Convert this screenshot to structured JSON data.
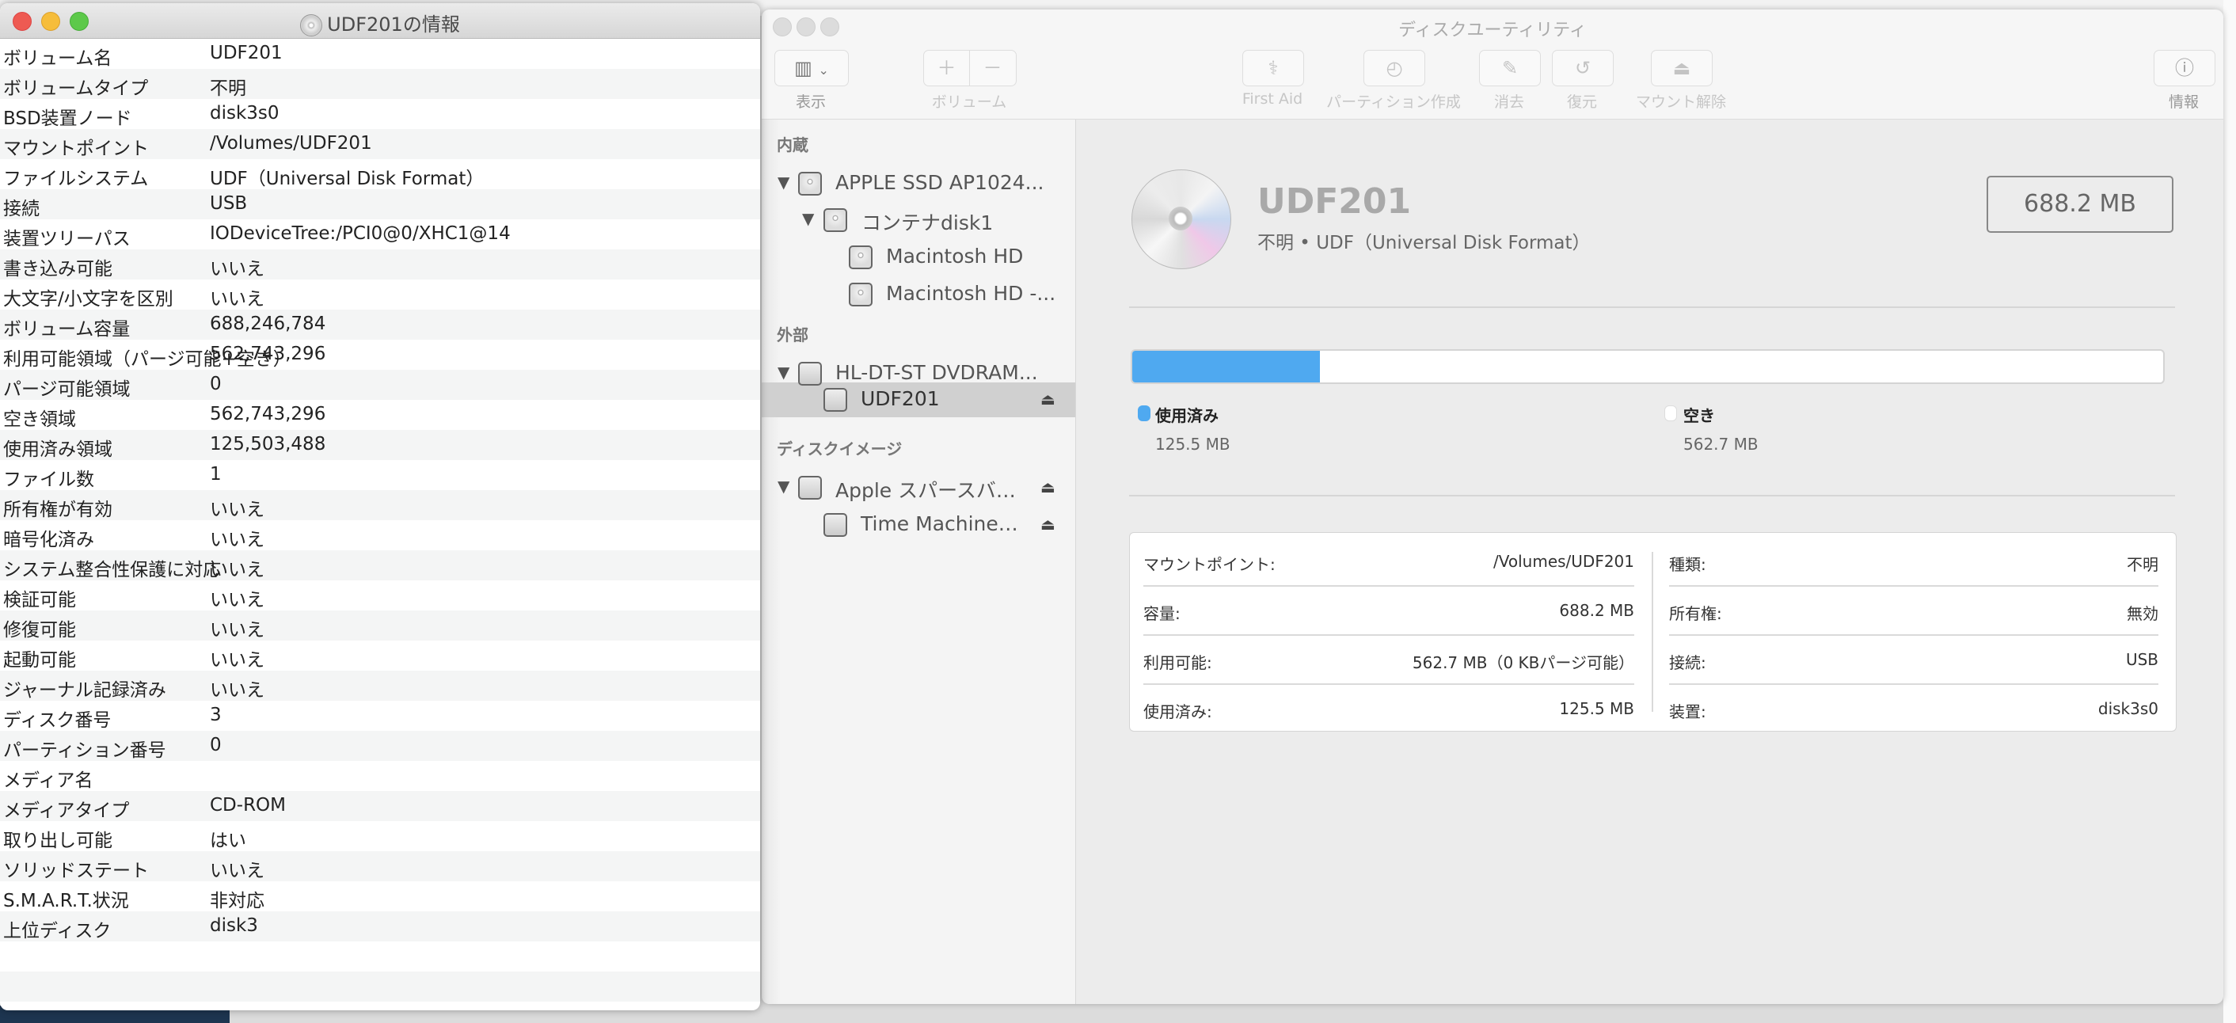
{
  "info_window": {
    "title": "UDF201の情報",
    "rows": [
      {
        "k": "ボリューム名",
        "v": "UDF201"
      },
      {
        "k": "ボリュームタイプ",
        "v": "不明"
      },
      {
        "k": "BSD装置ノード",
        "v": "disk3s0"
      },
      {
        "k": "マウントポイント",
        "v": "/Volumes/UDF201"
      },
      {
        "k": "ファイルシステム",
        "v": "UDF（Universal Disk Format）"
      },
      {
        "k": "接続",
        "v": "USB"
      },
      {
        "k": "装置ツリーパス",
        "v": "IODeviceTree:/PCI0@0/XHC1@14"
      },
      {
        "k": "書き込み可能",
        "v": "いいえ"
      },
      {
        "k": "大文字/小文字を区別",
        "v": "いいえ"
      },
      {
        "k": "ボリューム容量",
        "v": "688,246,784"
      },
      {
        "k": "利用可能領域（パージ可能+空き）",
        "v": "562,743,296"
      },
      {
        "k": "パージ可能領域",
        "v": "0"
      },
      {
        "k": "空き領域",
        "v": "562,743,296"
      },
      {
        "k": "使用済み領域",
        "v": "125,503,488"
      },
      {
        "k": "ファイル数",
        "v": "1"
      },
      {
        "k": "所有権が有効",
        "v": "いいえ"
      },
      {
        "k": "暗号化済み",
        "v": "いいえ"
      },
      {
        "k": "システム整合性保護に対応",
        "v": "いいえ"
      },
      {
        "k": "検証可能",
        "v": "いいえ"
      },
      {
        "k": "修復可能",
        "v": "いいえ"
      },
      {
        "k": "起動可能",
        "v": "いいえ"
      },
      {
        "k": "ジャーナル記録済み",
        "v": "いいえ"
      },
      {
        "k": "ディスク番号",
        "v": "3"
      },
      {
        "k": "パーティション番号",
        "v": "0"
      },
      {
        "k": "メディア名",
        "v": ""
      },
      {
        "k": "メディアタイプ",
        "v": "CD-ROM"
      },
      {
        "k": "取り出し可能",
        "v": "はい"
      },
      {
        "k": "ソリッドステート",
        "v": "いいえ"
      },
      {
        "k": "S.M.A.R.T.状況",
        "v": "非対応"
      },
      {
        "k": "上位ディスク",
        "v": "disk3"
      }
    ]
  },
  "disk_utility": {
    "title": "ディスクユーティリティ",
    "toolbar": {
      "view": "表示",
      "volume": "ボリューム",
      "first_aid": "First Aid",
      "partition": "パーティション作成",
      "erase": "消去",
      "restore": "復元",
      "unmount": "マウント解除",
      "info": "情報"
    },
    "sidebar": {
      "internal": "内蔵",
      "external": "外部",
      "disk_images": "ディスクイメージ",
      "items": [
        "APPLE SSD AP1024...",
        "コンテナdisk1",
        "Macintosh HD",
        "Macintosh HD -...",
        "HL-DT-ST DVDRAM...",
        "UDF201",
        "Apple スパースバ…",
        "Time Machine…"
      ],
      "selected": "UDF201"
    },
    "volume": {
      "name": "UDF201",
      "subtitle": "不明 • UDF（Universal Disk Format）",
      "size": "688.2 MB",
      "usage_fraction": 0.1824,
      "used_label": "使用済み",
      "used_value": "125.5 MB",
      "free_label": "空き",
      "free_value": "562.7 MB",
      "used_color": "#4fa9f0",
      "free_color": "#ffffff"
    },
    "details": {
      "left": [
        {
          "k": "マウントポイント:",
          "v": "/Volumes/UDF201"
        },
        {
          "k": "容量:",
          "v": "688.2 MB"
        },
        {
          "k": "利用可能:",
          "v": "562.7 MB（0 KBパージ可能）"
        },
        {
          "k": "使用済み:",
          "v": "125.5 MB"
        }
      ],
      "right": [
        {
          "k": "種類:",
          "v": "不明"
        },
        {
          "k": "所有権:",
          "v": "無効"
        },
        {
          "k": "接続:",
          "v": "USB"
        },
        {
          "k": "装置:",
          "v": "disk3s0"
        }
      ]
    }
  }
}
